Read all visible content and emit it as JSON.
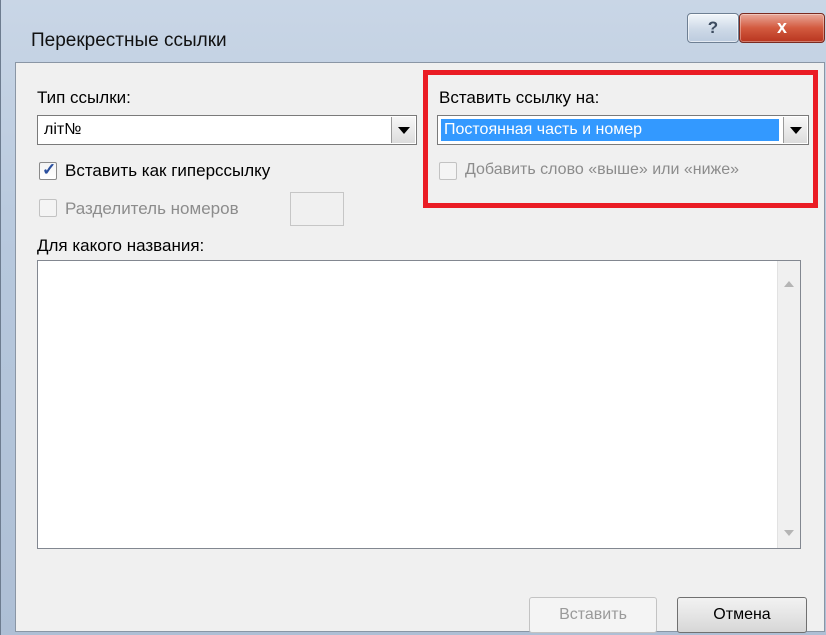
{
  "dialog": {
    "title": "Перекрестные ссылки",
    "help_glyph": "?",
    "close_glyph": "x"
  },
  "ref_type": {
    "label": "Тип ссылки:",
    "value": "літ№"
  },
  "insert_as_hyperlink": {
    "label": "Вставить как гиперссылку",
    "checked": true
  },
  "separator": {
    "label": "Разделитель номеров",
    "checked": false,
    "enabled": false,
    "value": ""
  },
  "insert_ref_to": {
    "label": "Вставить ссылку на:",
    "value": "Постоянная часть и номер"
  },
  "above_below": {
    "label": "Добавить слово «выше» или «ниже»",
    "checked": false,
    "enabled": false
  },
  "for_which_caption": {
    "label": "Для какого названия:",
    "items": []
  },
  "buttons": {
    "insert": "Вставить",
    "cancel": "Отмена"
  },
  "colors": {
    "highlight": "#ea1c24",
    "selection": "#3399ff"
  }
}
